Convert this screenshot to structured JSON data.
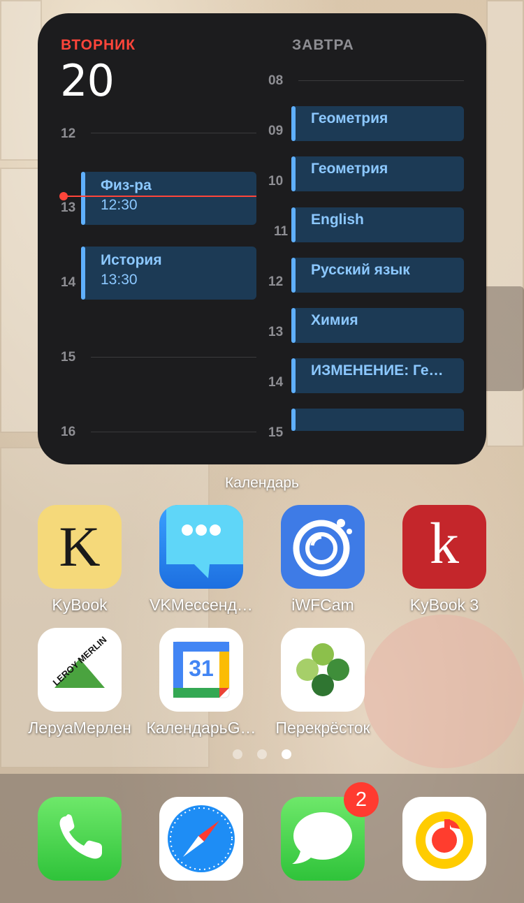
{
  "widget": {
    "today_label": "ВТОРНИК",
    "today_number": "20",
    "tomorrow_label": "ЗАВТРА",
    "left_hours": [
      "12",
      "13",
      "14",
      "15",
      "16"
    ],
    "right_hours": [
      "08",
      "09",
      "10",
      "11",
      "12",
      "13",
      "14",
      "15"
    ],
    "today_events": [
      {
        "title": "Физ-ра",
        "time": "12:30"
      },
      {
        "title": "История",
        "time": "13:30"
      }
    ],
    "tomorrow_events": [
      {
        "title": "Геометрия"
      },
      {
        "title": "Геометрия"
      },
      {
        "title": "English"
      },
      {
        "title": "Русский язык"
      },
      {
        "title": "Химия"
      },
      {
        "title": "ИЗМЕНЕНИЕ: Ге…"
      },
      {
        "title": ""
      }
    ],
    "name": "Календарь"
  },
  "apps": [
    {
      "label": "KyBook",
      "icon": "kybook-icon"
    },
    {
      "label": "VKМессенд…",
      "icon": "vk-messenger-icon"
    },
    {
      "label": "iWFCam",
      "icon": "iwfcam-icon"
    },
    {
      "label": "KyBook 3",
      "icon": "kybook3-icon"
    },
    {
      "label": "ЛеруаМерлен",
      "icon": "leroy-merlin-icon"
    },
    {
      "label": "КалендарьG…",
      "icon": "google-calendar-icon"
    },
    {
      "label": "Перекрёсток",
      "icon": "perekrestok-icon"
    }
  ],
  "app_glyphs": {
    "kybook": "K",
    "kybook3": "k",
    "leroy": "LEROY MERLIN",
    "gcal": "31"
  },
  "dock": [
    {
      "name": "phone",
      "icon": "phone-icon"
    },
    {
      "name": "safari",
      "icon": "safari-icon"
    },
    {
      "name": "messages",
      "icon": "messages-icon",
      "badge": "2"
    },
    {
      "name": "yandex-music",
      "icon": "music-icon"
    }
  ],
  "page_indicator": {
    "pages": 3,
    "current": 3
  },
  "colors": {
    "accent_red": "#ff453a",
    "event_blue": "#1c3a55",
    "event_text": "#8cc8ff"
  }
}
